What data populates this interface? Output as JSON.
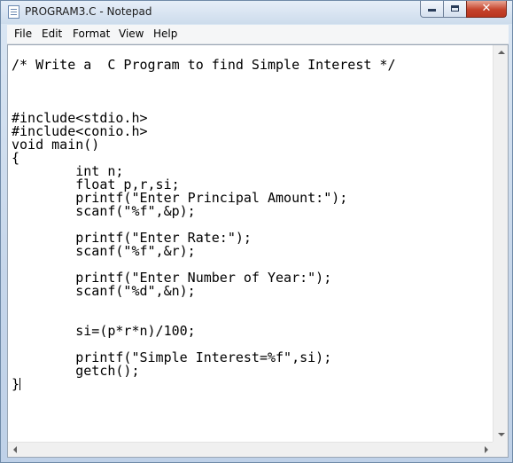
{
  "window": {
    "title": "PROGRAM3.C - Notepad",
    "minimize_glyph": "",
    "close_glyph": "✕"
  },
  "menu": {
    "items": [
      {
        "label": "File"
      },
      {
        "label": "Edit"
      },
      {
        "label": "Format"
      },
      {
        "label": "View"
      },
      {
        "label": "Help"
      }
    ]
  },
  "editor": {
    "content": "/* Write a  C Program to find Simple Interest */\n\n\n\n#include<stdio.h>\n#include<conio.h>\nvoid main()\n{\n\tint n;\n\tfloat p,r,si;\n\tprintf(\"Enter Principal Amount:\");\n\tscanf(\"%f\",&p);\n\n\tprintf(\"Enter Rate:\");\n\tscanf(\"%f\",&r);\n\n\tprintf(\"Enter Number of Year:\");\n\tscanf(\"%d\",&n);\n\n\n\tsi=(p*r*n)/100;\n\n\tprintf(\"Simple Interest=%f\",si);\n\tgetch();\n}"
  },
  "icons": {
    "app": "notepad-icon",
    "minimize": "minimize-icon",
    "maximize": "maximize-icon",
    "close": "close-icon"
  },
  "colors": {
    "close_button": "#c5432b",
    "title_bar": "#cddcec"
  }
}
